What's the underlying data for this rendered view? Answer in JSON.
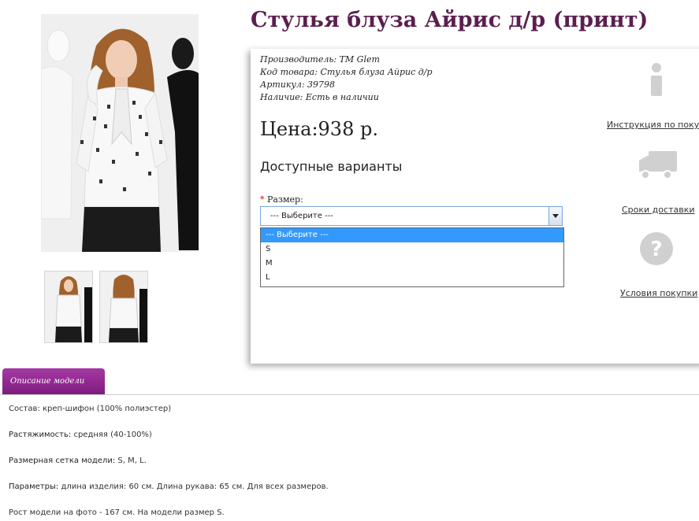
{
  "product": {
    "title": "Стулья блуза Айрис д/р (принт)",
    "manufacturer_label": "Производитель:",
    "manufacturer_value": "TM Glem",
    "code_label": "Код товара:",
    "code_value": "Стулья блуза Айрис д/р",
    "article_label": "Артикул:",
    "article_value": "39798",
    "stock_label": "Наличие:",
    "stock_value": "Есть в наличии",
    "price": "Цена:938 р.",
    "variants_heading": "Доступные варианты"
  },
  "size_select": {
    "required_mark": "*",
    "label": "Размер:",
    "selected": "--- Выберите ---",
    "options": [
      "--- Выберите ---",
      "S",
      "M",
      "L"
    ]
  },
  "side": {
    "instruction": "Инструкция по покупке",
    "delivery": "Сроки доставки",
    "terms": "Условия покупки"
  },
  "tabs": {
    "description": "Описание модели"
  },
  "description": {
    "composition": "Состав: креп-шифон (100% полиэстер)",
    "stretch_label": "Растяжимость:",
    "stretch_value": "средняя (40-100%)",
    "sizes_label": "Размерная сетка модели:",
    "sizes_value": "S, M, L.",
    "params_label": "Параметры:",
    "params_value": "длина изделия: 60 см. Длина рукава: 65 см. Для всех размеров.",
    "model_info": "Рост модели на фото - 167 см. На модели размер S."
  },
  "icons": {
    "info": "info-icon",
    "delivery": "truck-icon",
    "terms": "question-icon"
  },
  "colors": {
    "title": "#5a1f4f",
    "tab": "#8b238b",
    "select_highlight": "#3399ff"
  }
}
